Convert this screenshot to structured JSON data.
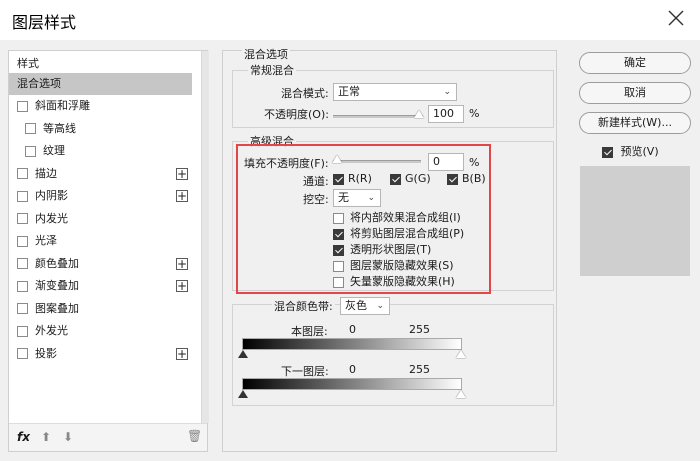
{
  "window": {
    "title": "图层样式"
  },
  "left_panel": {
    "header": "样式",
    "selected": "混合选项",
    "items": [
      {
        "label": "斜面和浮雕",
        "checked": false,
        "indent": false,
        "plus": false
      },
      {
        "label": "等高线",
        "checked": false,
        "indent": true,
        "plus": false
      },
      {
        "label": "纹理",
        "checked": false,
        "indent": true,
        "plus": false
      },
      {
        "label": "描边",
        "checked": false,
        "indent": false,
        "plus": true
      },
      {
        "label": "内阴影",
        "checked": false,
        "indent": false,
        "plus": true
      },
      {
        "label": "内发光",
        "checked": false,
        "indent": false,
        "plus": false
      },
      {
        "label": "光泽",
        "checked": false,
        "indent": false,
        "plus": false
      },
      {
        "label": "颜色叠加",
        "checked": false,
        "indent": false,
        "plus": true
      },
      {
        "label": "渐变叠加",
        "checked": false,
        "indent": false,
        "plus": true
      },
      {
        "label": "图案叠加",
        "checked": false,
        "indent": false,
        "plus": false
      },
      {
        "label": "外发光",
        "checked": false,
        "indent": false,
        "plus": false
      },
      {
        "label": "投影",
        "checked": false,
        "indent": false,
        "plus": true
      }
    ],
    "plus_symbol": "+",
    "bottom": {
      "fx": "fx",
      "up": "⬆",
      "down": "⬇",
      "trash": "🗑"
    }
  },
  "blend_options": {
    "section_title": "混合选项",
    "general": {
      "title": "常规混合",
      "mode_label": "混合模式:",
      "mode_value": "正常",
      "opacity_label": "不透明度(O):",
      "opacity_value": "100",
      "opacity_unit": "%"
    },
    "advanced": {
      "title": "高级混合",
      "fill_label": "填充不透明度(F):",
      "fill_value": "0",
      "fill_unit": "%",
      "channels_label": "通道:",
      "channels": [
        {
          "label": "R(R)",
          "checked": true
        },
        {
          "label": "G(G)",
          "checked": true
        },
        {
          "label": "B(B)",
          "checked": true
        }
      ],
      "knockout_label": "挖空:",
      "knockout_value": "无",
      "options": [
        {
          "label": "将内部效果混合成组(I)",
          "checked": false
        },
        {
          "label": "将剪贴图层混合成组(P)",
          "checked": true
        },
        {
          "label": "透明形状图层(T)",
          "checked": true
        },
        {
          "label": "图层蒙版隐藏效果(S)",
          "checked": false
        },
        {
          "label": "矢量蒙版隐藏效果(H)",
          "checked": false
        }
      ]
    },
    "blend_if": {
      "label": "混合颜色带:",
      "value": "灰色",
      "this_layer": "本图层:",
      "this_min": "0",
      "this_max": "255",
      "underlying": "下一图层:",
      "under_min": "0",
      "under_max": "255"
    }
  },
  "buttons": {
    "ok": "确定",
    "cancel": "取消",
    "new_style": "新建样式(W)...",
    "preview_label": "预览(V)",
    "preview_checked": true
  },
  "colors": {
    "highlight": "#e24646",
    "selected_row": "#c6c6c6"
  }
}
